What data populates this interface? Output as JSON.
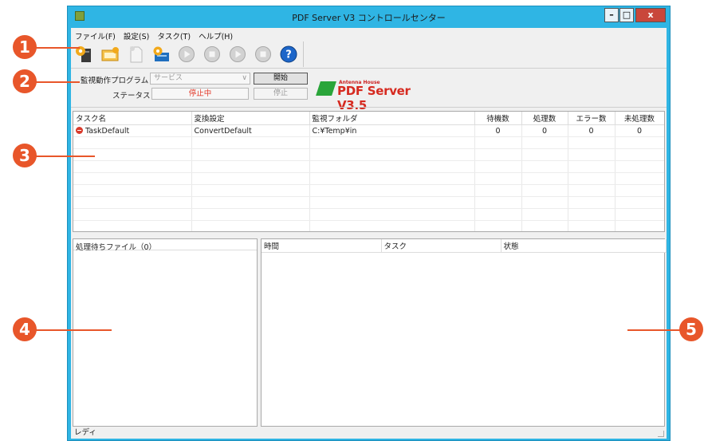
{
  "window": {
    "title": "PDF Server V3 コントロールセンター",
    "min_label": "–",
    "max_label": "□",
    "close_label": "x"
  },
  "menu": [
    "ファイル(F)",
    "設定(S)",
    "タスク(T)",
    "ヘルプ(H)"
  ],
  "toolbar": {
    "icons": [
      "server-settings-icon",
      "monitor-config-icon",
      "document-icon",
      "task-settings-icon",
      "play-icon",
      "stop-icon",
      "play-icon",
      "stop-icon",
      "help-icon"
    ],
    "help_label": "?"
  },
  "status": {
    "program_label": "監視動作プログラム",
    "program_value": "サービス",
    "start_button": "開始",
    "status_label": "ステータス",
    "status_value": "停止中",
    "stop_button": "停止",
    "logo_maker": "Antenna House",
    "logo_name": "PDF Server V3.5"
  },
  "tasks": {
    "columns": [
      "タスク名",
      "変換設定",
      "監視フォルダ",
      "待機数",
      "処理数",
      "エラー数",
      "未処理数"
    ],
    "rows": [
      {
        "name": "TaskDefault",
        "setting": "ConvertDefault",
        "folder": "C:¥Temp¥in",
        "waiting": "0",
        "processed": "0",
        "errors": "0",
        "unprocessed": "0"
      }
    ]
  },
  "files_panel": {
    "header": "処理待ちファイル（0）"
  },
  "log_panel": {
    "columns": [
      "時間",
      "タスク",
      "状態"
    ]
  },
  "statusbar": {
    "text": "レディ"
  },
  "callouts": [
    "1",
    "2",
    "3",
    "4",
    "5"
  ],
  "colors": {
    "accent": "#e8562a",
    "titlebar": "#2fb5e4",
    "status_red": "#e23b2b"
  }
}
